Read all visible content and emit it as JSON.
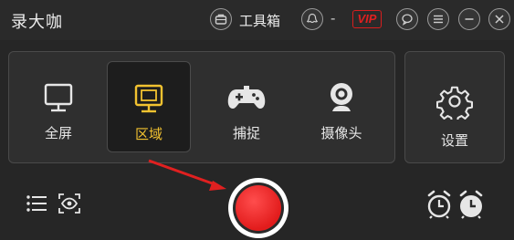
{
  "window": {
    "title": "录大咖"
  },
  "titlebar": {
    "toolbox_label": "工具箱",
    "dash": "-",
    "vip_label": "VIP",
    "icons": [
      "toolbox-icon",
      "user-avatar-icon",
      "chat-icon",
      "menu-icon",
      "minimize-icon",
      "close-icon"
    ]
  },
  "modes": [
    {
      "label": "全屏",
      "icon": "monitor-icon",
      "active": false
    },
    {
      "label": "区域",
      "icon": "monitor-icon",
      "active": true
    },
    {
      "label": "捕捉",
      "icon": "gamepad-icon",
      "active": false
    },
    {
      "label": "摄像头",
      "icon": "webcam-icon",
      "active": false
    }
  ],
  "settings": {
    "label": "设置",
    "icon": "gear-icon"
  },
  "bottom": {
    "left_icons": [
      "list-icon",
      "eye-scan-icon"
    ],
    "right_icons": [
      "alarm-start-icon",
      "alarm-stop-icon"
    ],
    "record_icon": "record-icon",
    "annotation": "arrow-icon"
  },
  "colors": {
    "background": "#262626",
    "active_label": "#f2c230",
    "record": "#e21c1c",
    "vip": "#e02020",
    "arrow": "#e02020"
  }
}
